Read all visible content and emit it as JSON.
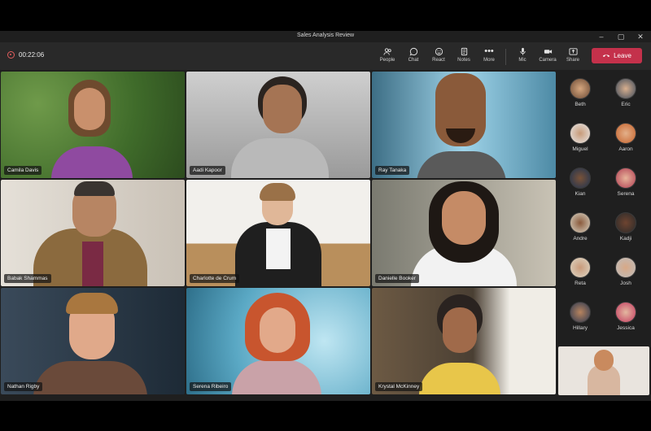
{
  "window": {
    "title": "Sales Analysis Review"
  },
  "toolbar": {
    "timer": "00:22:06",
    "buttons": {
      "people": "People",
      "chat": "Chat",
      "react": "React",
      "notes": "Notes",
      "more": "More",
      "mic": "Mic",
      "camera": "Camera",
      "share": "Share"
    },
    "leave": "Leave"
  },
  "participants": [
    {
      "name": "Camila Davis"
    },
    {
      "name": "Aadi Kapoor"
    },
    {
      "name": "Ray Tanaka"
    },
    {
      "name": "Babak Shammas"
    },
    {
      "name": "Charlotte de Crum"
    },
    {
      "name": "Danielle Booker"
    },
    {
      "name": "Nathan Rigby"
    },
    {
      "name": "Serena Ribeiro"
    },
    {
      "name": "Krystal McKinney"
    }
  ],
  "rail": [
    {
      "name": "Beth"
    },
    {
      "name": "Eric"
    },
    {
      "name": "Miguel"
    },
    {
      "name": "Aaron"
    },
    {
      "name": "Kian"
    },
    {
      "name": "Serena"
    },
    {
      "name": "Andre"
    },
    {
      "name": "Kadji"
    },
    {
      "name": "Reta"
    },
    {
      "name": "Josh"
    },
    {
      "name": "Hillary"
    },
    {
      "name": "Jessica"
    }
  ],
  "colors": {
    "leave": "#c4314b",
    "window": "#1f1f1f",
    "toolbar": "#292929"
  }
}
